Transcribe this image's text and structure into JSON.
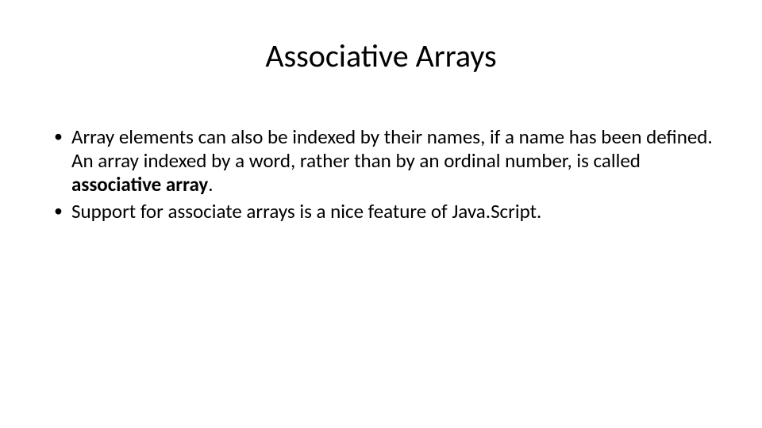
{
  "slide": {
    "title": "Associative Arrays",
    "bullets": [
      {
        "pre": "Array elements can also be indexed by their names, if a name has been defined. An array indexed by a word, rather than by an ordinal number, is called ",
        "bold": "associative array",
        "post": "."
      },
      {
        "pre": "Support for associate arrays is a nice feature of Java.Script.",
        "bold": "",
        "post": ""
      }
    ]
  }
}
